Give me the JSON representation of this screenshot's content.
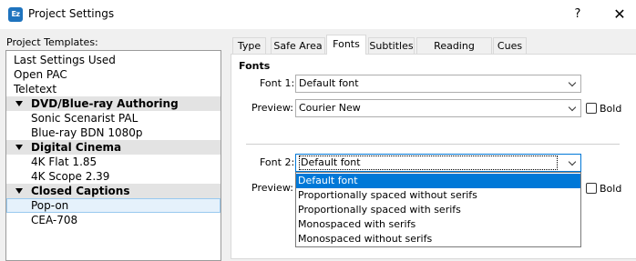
{
  "window": {
    "icon_text": "Ez",
    "title": "Project Settings",
    "help_label": "?",
    "close_label": "✕"
  },
  "templates": {
    "label": "Project Templates:",
    "items": [
      {
        "label": "Last Settings Used"
      },
      {
        "label": "Open PAC"
      },
      {
        "label": "Teletext"
      },
      {
        "label": "DVD/Blue-ray Authoring"
      },
      {
        "label": "Sonic Scenarist PAL"
      },
      {
        "label": "Blue-ray BDN 1080p"
      },
      {
        "label": "Digital Cinema"
      },
      {
        "label": "4K Flat 1.85"
      },
      {
        "label": "4K Scope 2.39"
      },
      {
        "label": "Closed Captions"
      },
      {
        "label": "Pop-on"
      },
      {
        "label": "CEA-708"
      }
    ]
  },
  "tabs": [
    {
      "label": "Type"
    },
    {
      "label": "Safe Area"
    },
    {
      "label": "Fonts"
    },
    {
      "label": "Subtitles"
    },
    {
      "label": "Reading Speed"
    },
    {
      "label": "Cues"
    }
  ],
  "fonts": {
    "heading": "Fonts",
    "font1": {
      "label": "Font 1:",
      "value": "Default font"
    },
    "preview1": {
      "label": "Preview:",
      "value": "Courier New"
    },
    "bold1": {
      "label": "Bold",
      "checked": false
    },
    "font2": {
      "label": "Font 2:",
      "value": "Default font"
    },
    "preview2": {
      "label": "Preview:"
    },
    "bold2": {
      "label": "Bold",
      "checked": false
    },
    "font2_options": [
      {
        "label": "Default font"
      },
      {
        "label": "Proportionally spaced without serifs"
      },
      {
        "label": "Proportionally spaced with serifs"
      },
      {
        "label": "Monospaced with serifs"
      },
      {
        "label": "Monospaced without serifs"
      }
    ]
  },
  "colors": {
    "accent": "#0078d7",
    "selection_row": "#e5f1fb",
    "group_header": "#e3e3e3"
  }
}
